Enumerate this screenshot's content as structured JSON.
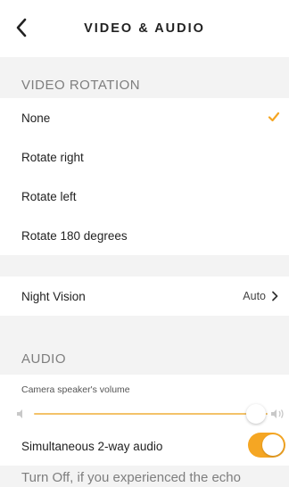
{
  "header": {
    "title": "VIDEO & AUDIO",
    "back_icon": "chevron-left-icon"
  },
  "video_rotation": {
    "section_label": "VIDEO ROTATION",
    "options": [
      {
        "label": "None",
        "selected": true
      },
      {
        "label": "Rotate right",
        "selected": false
      },
      {
        "label": "Rotate left",
        "selected": false
      },
      {
        "label": "Rotate 180 degrees",
        "selected": false
      }
    ],
    "check_icon": "checkmark-icon"
  },
  "night_vision": {
    "label": "Night Vision",
    "value": "Auto",
    "chevron_icon": "chevron-right-icon"
  },
  "audio": {
    "section_label": "AUDIO",
    "volume_label": "Camera speaker's volume",
    "volume_level": 0.95,
    "volume_low_icon": "speaker-low-icon",
    "volume_high_icon": "speaker-high-icon",
    "two_way_label": "Simultaneous 2-way audio",
    "two_way_enabled": true,
    "note": "Turn Off, if you experienced the echo"
  },
  "colors": {
    "accent": "#f5a623",
    "track": "#f3c269",
    "section_bg": "#f3f3f3",
    "section_text": "#7e7e7e"
  }
}
